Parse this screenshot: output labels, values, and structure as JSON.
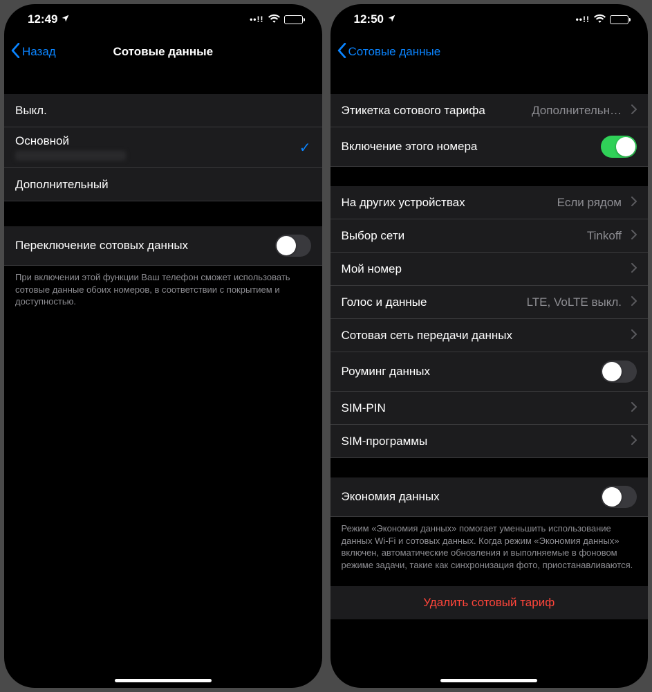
{
  "left": {
    "status_time": "12:49",
    "back_label": "Назад",
    "title": "Сотовые данные",
    "options": {
      "off": "Выкл.",
      "primary": "Основной",
      "secondary": "Дополнительный"
    },
    "switching_label": "Переключение сотовых данных",
    "switching_on": false,
    "footer": "При включении этой функции Ваш телефон сможет использовать сотовые данные обоих номеров, в соответствии с покрытием и доступностью."
  },
  "right": {
    "status_time": "12:50",
    "back_label": "Сотовые данные",
    "rows": {
      "label_title": "Этикетка сотового тарифа",
      "label_value": "Дополнительн…",
      "enable_label": "Включение этого номера",
      "enable_on": true,
      "other_devices_label": "На других устройствах",
      "other_devices_value": "Если рядом",
      "network_label": "Выбор сети",
      "network_value": "Tinkoff",
      "my_number_label": "Мой номер",
      "voice_data_label": "Голос и данные",
      "voice_data_value": "LTE, VoLTE выкл.",
      "cellular_net_label": "Сотовая сеть передачи данных",
      "roaming_label": "Роуминг данных",
      "roaming_on": false,
      "sim_pin_label": "SIM-PIN",
      "sim_apps_label": "SIM-программы",
      "low_data_label": "Экономия данных",
      "low_data_on": false
    },
    "low_data_footer": "Режим «Экономия данных» помогает уменьшить использование данных Wi-Fi и сотовых данных. Когда режим «Экономия данных» включен, автоматические обновления и выполняемые в фоновом режиме задачи, такие как синхронизация фото, приостанавливаются.",
    "delete_label": "Удалить сотовый тариф"
  }
}
